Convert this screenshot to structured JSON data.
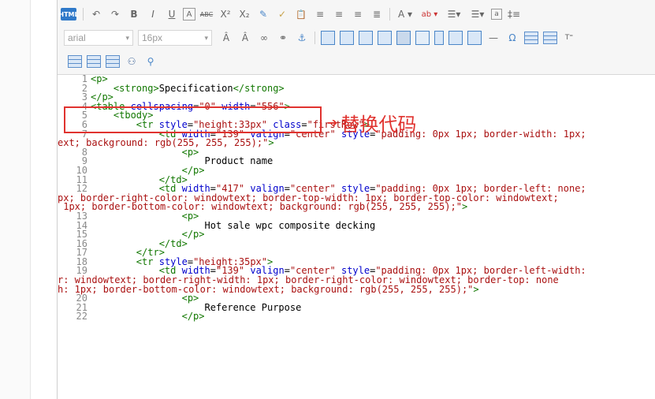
{
  "toolbar": {
    "html_label": "HTML",
    "font_family": "arial",
    "font_size": "16px",
    "row1_icons": [
      "undo-icon",
      "redo-icon",
      "bold-icon",
      "italic-icon",
      "underline-icon",
      "border-icon",
      "strikethrough-icon",
      "superscript-icon",
      "subscript-icon",
      "eraser-icon",
      "format-painter-icon",
      "paste-icon",
      "align-left-icon",
      "align-center-icon",
      "align-right-icon",
      "justify-icon",
      "font-color-icon",
      "highlight-icon",
      "ordered-list-icon",
      "unordered-list-icon",
      "insert-icon",
      "line-height-icon"
    ],
    "row1_glyphs": {
      "undo": "↶",
      "redo": "↷",
      "bold": "B",
      "italic": "I",
      "underline": "U",
      "border": "A",
      "strike": "ABC",
      "sup": "X²",
      "sub": "X₂",
      "eraser": "✎",
      "painter": "✓",
      "paste": "📋",
      "font_color": "A ▾",
      "highlight": "ab ▾"
    }
  },
  "annotation": {
    "arrow": "➔",
    "text": "替换代码"
  },
  "code": {
    "lines": [
      {
        "n": "1",
        "html": "<span class='tag'>&lt;p&gt;</span>"
      },
      {
        "n": "2",
        "html": "    <span class='tag'>&lt;strong&gt;</span><span class='txt'>Specification</span><span class='tag'>&lt;/strong&gt;</span>"
      },
      {
        "n": "3",
        "html": "<span class='tag'>&lt;/p&gt;</span>"
      },
      {
        "n": "4",
        "html": "<span class='tag'>&lt;table</span> <span class='attr'>cellspacing</span>=<span class='str'>\"0\"</span> <span class='attr'>width</span>=<span class='str'>\"556\"</span><span class='tag'>&gt;</span>"
      },
      {
        "n": "5",
        "html": "    <span class='tag'>&lt;tbody&gt;</span>"
      },
      {
        "n": "6",
        "html": "        <span class='tag'>&lt;tr</span> <span class='attr'>style</span>=<span class='str'>\"height:33px\"</span> <span class='attr'>class</span>=<span class='str'>\"firstRow\"</span><span class='tag'>&gt;</span>"
      },
      {
        "n": "7",
        "html": "            <span class='tag'>&lt;td</span> <span class='attr'>width</span>=<span class='str'>\"139\"</span> <span class='attr'>valign</span>=<span class='str'>\"center\"</span> <span class='attr'>style</span>=<span class='str'>\"padding: 0px 1px; border-width: 1px;</span>"
      },
      {
        "n": "",
        "html": "<span class='str'>ext; background: rgb(255, 255, 255);\"</span><span class='tag'>&gt;</span>"
      },
      {
        "n": "8",
        "html": "                <span class='tag'>&lt;p&gt;</span>"
      },
      {
        "n": "9",
        "html": "                    <span class='txt'>Product name</span>"
      },
      {
        "n": "10",
        "html": "                <span class='tag'>&lt;/p&gt;</span>"
      },
      {
        "n": "11",
        "html": "            <span class='tag'>&lt;/td&gt;</span>"
      },
      {
        "n": "12",
        "html": "            <span class='tag'>&lt;td</span> <span class='attr'>width</span>=<span class='str'>\"417\"</span> <span class='attr'>valign</span>=<span class='str'>\"center\"</span> <span class='attr'>style</span>=<span class='str'>\"padding: 0px 1px; border-left: none;</span>"
      },
      {
        "n": "",
        "html": "<span class='str'>px; border-right-color: windowtext; border-top-width: 1px; border-top-color: windowtext;</span>"
      },
      {
        "n": "",
        "html": "<span class='str'> 1px; border-bottom-color: windowtext; background: rgb(255, 255, 255);\"</span><span class='tag'>&gt;</span>"
      },
      {
        "n": "13",
        "html": "                <span class='tag'>&lt;p&gt;</span>"
      },
      {
        "n": "14",
        "html": "                    <span class='txt'>Hot sale wpc composite decking</span>"
      },
      {
        "n": "15",
        "html": "                <span class='tag'>&lt;/p&gt;</span>"
      },
      {
        "n": "16",
        "html": "            <span class='tag'>&lt;/td&gt;</span>"
      },
      {
        "n": "17",
        "html": "        <span class='tag'>&lt;/tr&gt;</span>"
      },
      {
        "n": "18",
        "html": "        <span class='tag'>&lt;tr</span> <span class='attr'>style</span>=<span class='str'>\"height:35px\"</span><span class='tag'>&gt;</span>"
      },
      {
        "n": "19",
        "html": "            <span class='tag'>&lt;td</span> <span class='attr'>width</span>=<span class='str'>\"139\"</span> <span class='attr'>valign</span>=<span class='str'>\"center\"</span> <span class='attr'>style</span>=<span class='str'>\"padding: 0px 1px; border-left-width:</span>"
      },
      {
        "n": "",
        "html": "<span class='str'>r: windowtext; border-right-width: 1px; border-right-color: windowtext; border-top: none</span>"
      },
      {
        "n": "",
        "html": "<span class='str'>h: 1px; border-bottom-color: windowtext; background: rgb(255, 255, 255);\"</span><span class='tag'>&gt;</span>"
      },
      {
        "n": "20",
        "html": "                <span class='tag'>&lt;p&gt;</span>"
      },
      {
        "n": "21",
        "html": "                    <span class='txt'>Reference Purpose</span>"
      },
      {
        "n": "22",
        "html": "                <span class='tag'>&lt;/p&gt;</span>"
      }
    ]
  }
}
